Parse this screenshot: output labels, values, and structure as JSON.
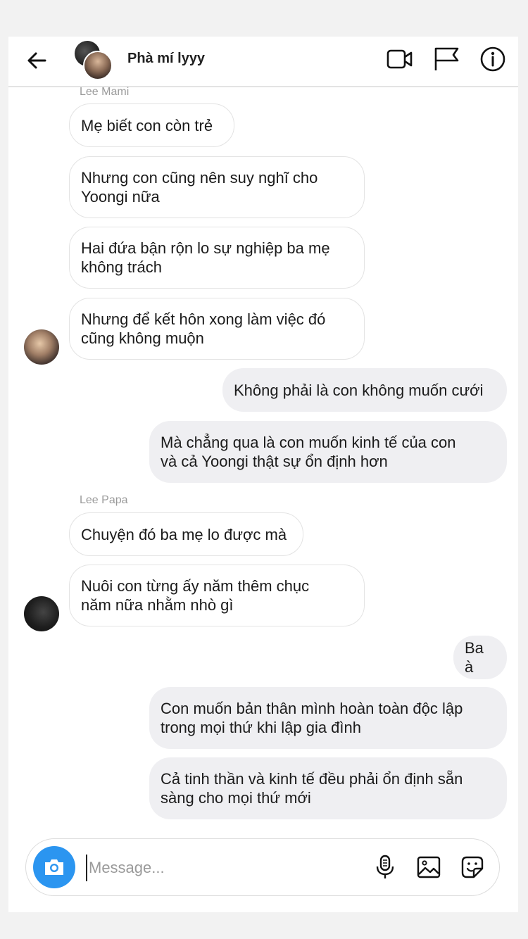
{
  "header": {
    "title": "Phà mí lyyy",
    "icons": [
      "back-arrow-icon",
      "video-call-icon",
      "flag-icon",
      "info-icon"
    ]
  },
  "messages": {
    "sender_mami": "Lee Mami",
    "m1": "Mẹ biết con còn trẻ",
    "m2": "Nhưng con cũng nên suy nghĩ cho\nYoongi nữa",
    "m3": "Hai đứa bận rộn lo sự nghiệp ba mẹ\nkhông trách",
    "m4": "Nhưng để kết hôn xong làm việc đó\ncũng không muộn",
    "o1": "Không phải là con không muốn cưới",
    "o2": "Mà chẳng qua là con muốn kinh tế của con\nvà cả Yoongi thật sự ổn định hơn",
    "sender_papa": "Lee Papa",
    "p1": "Chuyện đó ba mẹ lo được mà",
    "p2": "Nuôi con từng ấy năm thêm chục\nnăm nữa nhằm nhò gì",
    "o3": "Ba à",
    "o4": "Con muốn bản thân mình hoàn toàn độc lập\ntrong mọi thứ khi lập gia đình",
    "o5": "Cả tinh thần và kinh tế đều phải ổn định sẵn\nsàng cho mọi thứ mới"
  },
  "composer": {
    "placeholder": "Message...",
    "value": "",
    "icons": [
      "camera-icon",
      "microphone-icon",
      "gallery-icon",
      "sticker-icon"
    ]
  },
  "colors": {
    "accent": "#2b95f0",
    "outgoing_bubble": "#efeff2",
    "incoming_border": "#e3e3e3"
  }
}
